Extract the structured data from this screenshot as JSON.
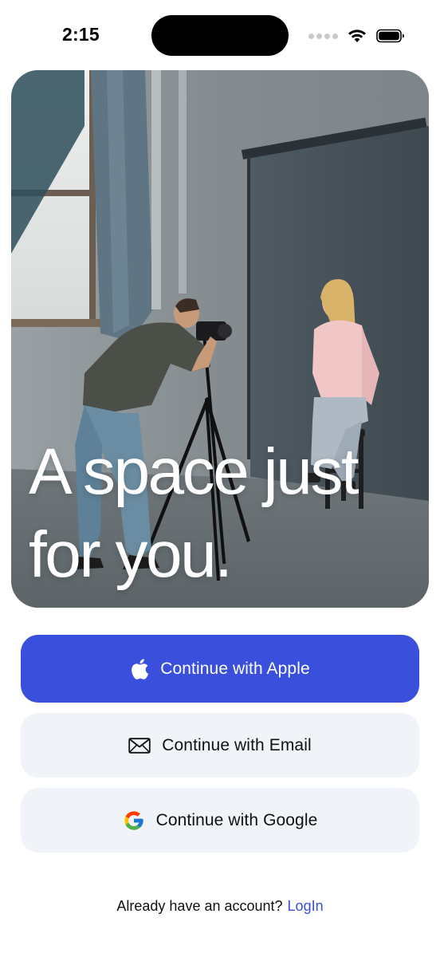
{
  "status_bar": {
    "time": "2:15"
  },
  "hero": {
    "title_line1": "A space just",
    "title_line2": "for you."
  },
  "auth": {
    "apple_label": "Continue with Apple",
    "email_label": "Continue with Email",
    "google_label": "Continue with Google"
  },
  "footer": {
    "prompt": "Already have an account?",
    "login_label": "LogIn"
  },
  "colors": {
    "primary": "#3a4fdc",
    "secondary_button_bg": "#f0f3f8"
  },
  "icons": {
    "apple": "apple-logo-icon",
    "email": "envelope-icon",
    "google": "google-logo-icon",
    "wifi": "wifi-icon",
    "battery": "battery-icon"
  }
}
